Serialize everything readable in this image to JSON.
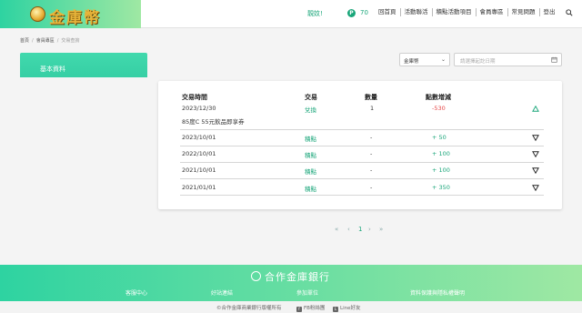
{
  "header": {
    "logo_text": "金庫幣",
    "greeting": "靚妏!",
    "points_badge": "P",
    "points": "70",
    "nav": [
      "回首頁",
      "活動聯活",
      "積點活動項目",
      "會員專區",
      "常見問題",
      "登出"
    ]
  },
  "breadcrumb": [
    "首頁",
    "會員專區",
    "交易查詢"
  ],
  "sidebar": {
    "items": [
      {
        "label": "基本資料"
      }
    ]
  },
  "filters": {
    "currency": "金庫幣",
    "date_placeholder": "請選擇起訖日期"
  },
  "table": {
    "headers": [
      "交易時間",
      "交易",
      "數量",
      "點數增減"
    ],
    "rows": [
      {
        "date": "2023/12/30",
        "type": "兌換",
        "qty": "1",
        "points": "-530",
        "desc": "85度C 55元飲品即享券",
        "direction": "up"
      },
      {
        "date": "2023/10/01",
        "type": "積點",
        "qty": "-",
        "points": "+ 50",
        "desc": "",
        "direction": "down"
      },
      {
        "date": "2022/10/01",
        "type": "積點",
        "qty": "-",
        "points": "+ 100",
        "desc": "",
        "direction": "down"
      },
      {
        "date": "2021/10/01",
        "type": "積點",
        "qty": "-",
        "points": "+ 100",
        "desc": "",
        "direction": "down"
      },
      {
        "date": "2021/01/01",
        "type": "積點",
        "qty": "-",
        "points": "+ 350",
        "desc": "",
        "direction": "down"
      }
    ]
  },
  "pagination": {
    "first": "«",
    "prev": "‹",
    "current": "1",
    "next": "›",
    "last": "»"
  },
  "footer": {
    "brand": "合作金庫銀行",
    "links": [
      "客服中心",
      "好站連結",
      "參加單位",
      "資料保護與隱私權聲明"
    ],
    "copyright": "©合作金庫商業銀行版權所有",
    "fb": "FB粉絲團",
    "line": "Line好友"
  },
  "colors": {
    "accent": "#1aa67a",
    "negative": "#e54848",
    "gradient_start": "#2ed3a1",
    "gradient_end": "#9fe8a3"
  },
  "icons": {
    "search": "search-icon",
    "calendar": "calendar-icon",
    "expand": "triangle-icon"
  }
}
